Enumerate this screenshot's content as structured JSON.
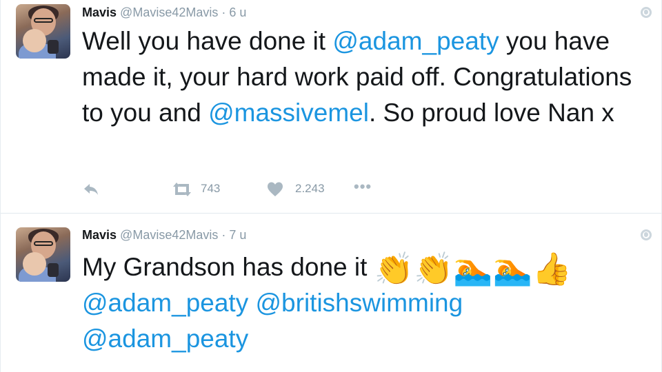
{
  "tweets": [
    {
      "author_name": "Mavis",
      "author_handle": "@Mavise42Mavis",
      "separator": "·",
      "time": "6 u",
      "text_parts": [
        "Well you have done it ",
        "@adam_peaty",
        " you have made it, your hard work paid off. Congratulations to you and ",
        "@massivemel",
        ". So proud love Nan x"
      ],
      "retweet_count": "743",
      "like_count": "2.243",
      "more_label": "•••"
    },
    {
      "author_name": "Mavis",
      "author_handle": "@Mavise42Mavis",
      "separator": "·",
      "time": "7 u",
      "text_parts": [
        "My Grandson has done it ",
        "👏👏🏊🏊👍",
        "@adam_peaty",
        " ",
        "@britishswimming",
        "@adam_peaty"
      ]
    }
  ],
  "icons": {
    "reply": "reply-icon",
    "retweet": "retweet-icon",
    "like": "heart-icon",
    "more": "more-icon",
    "globe": "globe-icon",
    "clap": "clapping-hands-emoji",
    "swim": "swimmer-emoji",
    "thumb": "thumbs-up-emoji"
  },
  "colors": {
    "link": "#1b95e0",
    "muted": "#8899a6",
    "icon": "#aab8c2",
    "text": "#14171a",
    "divider": "#e1e8ed"
  }
}
